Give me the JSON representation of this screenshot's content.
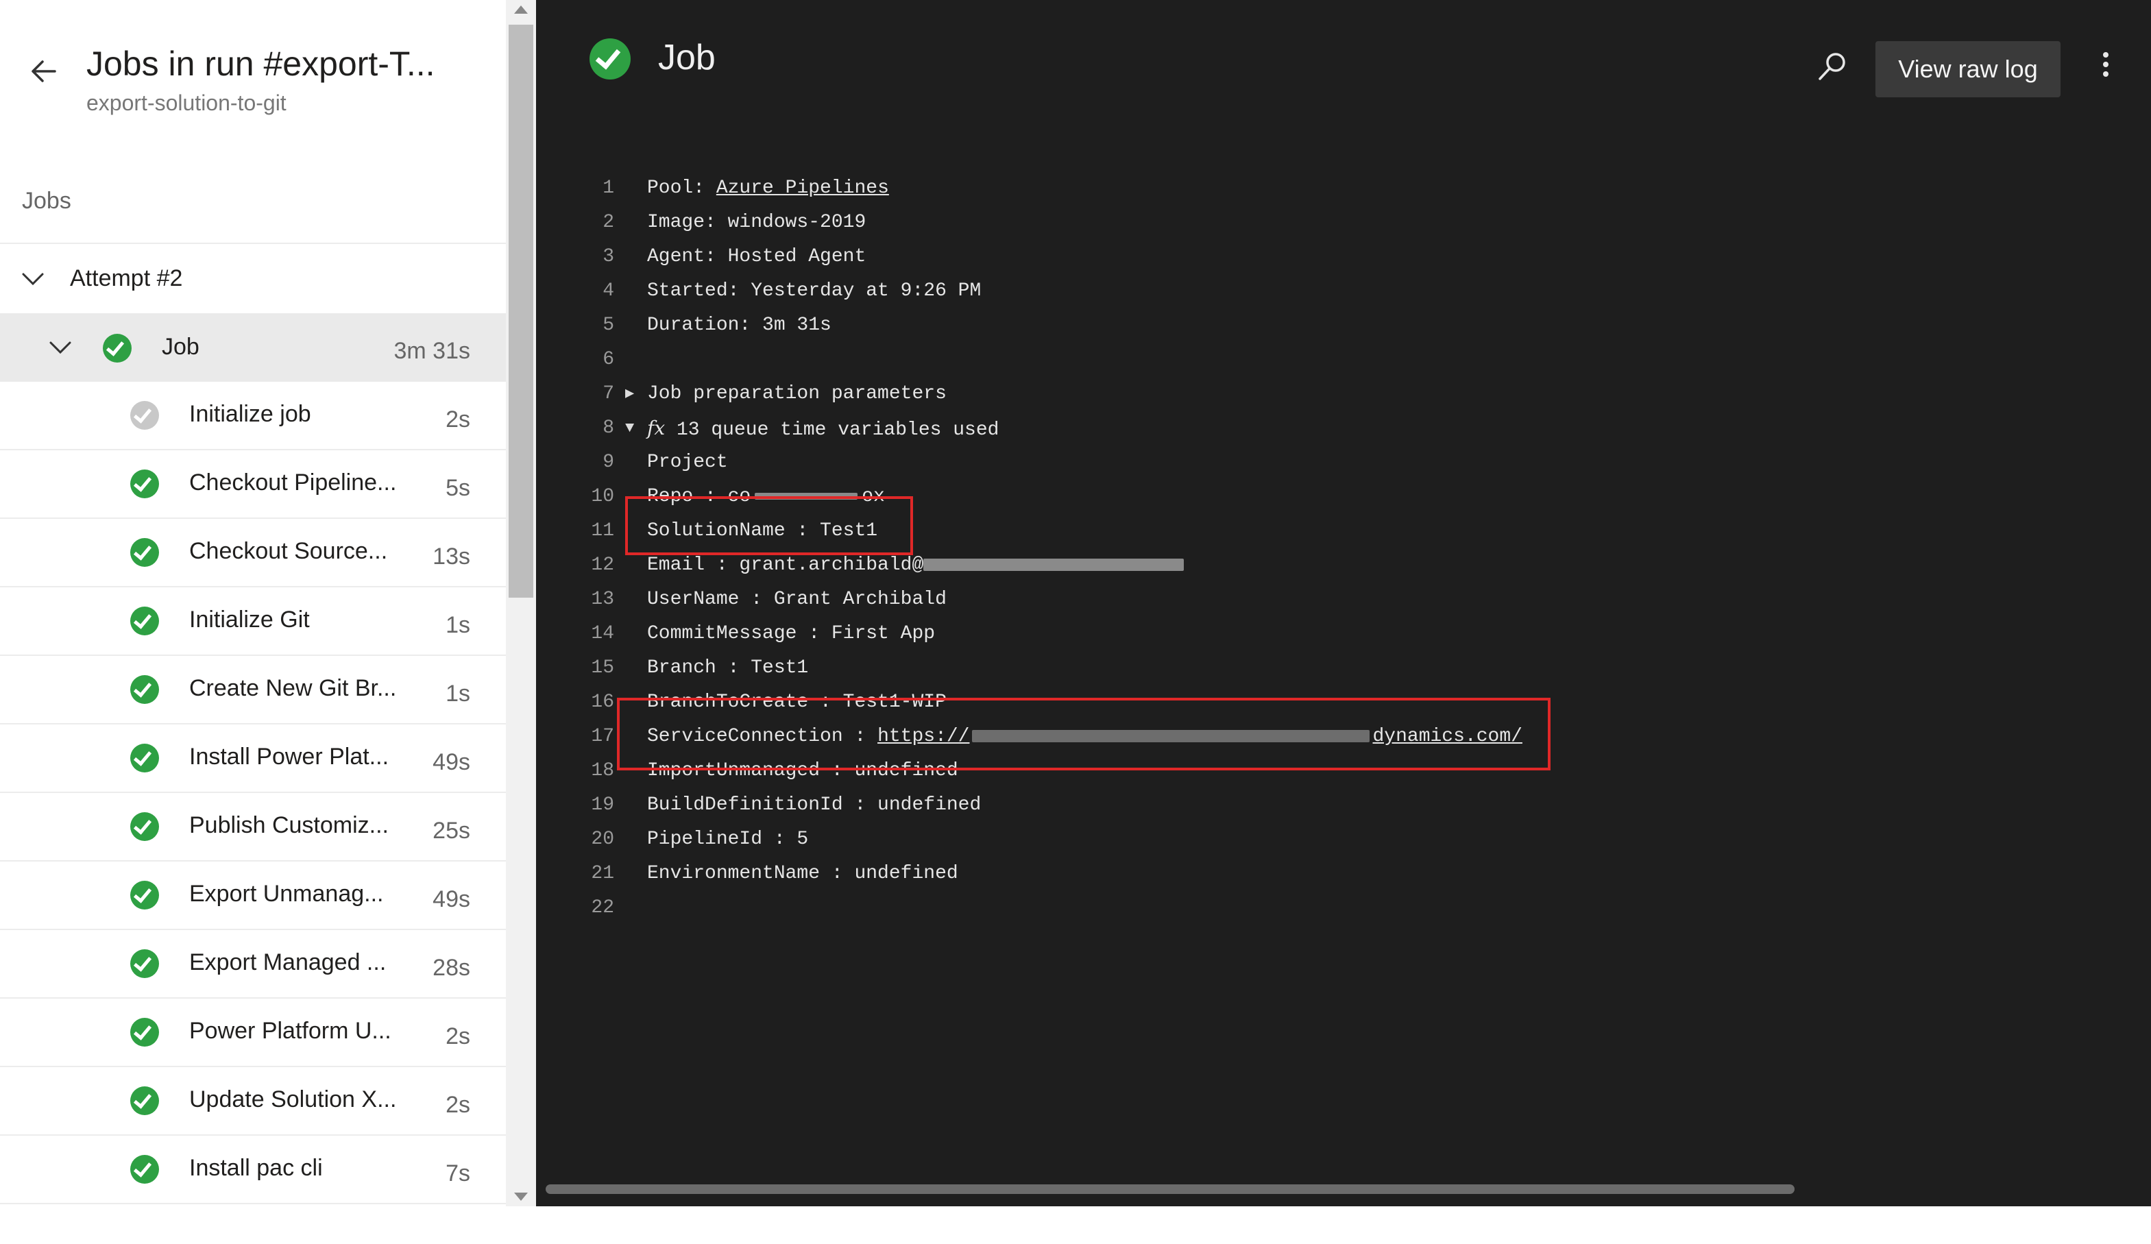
{
  "header": {
    "run_title": "Jobs in run #export-T...",
    "run_subtitle": "export-solution-to-git"
  },
  "sidebar": {
    "section_label": "Jobs",
    "attempt_label": "Attempt #2",
    "job": {
      "label": "Job",
      "duration": "3m 31s",
      "status": "succeeded"
    },
    "steps": [
      {
        "label": "Initialize job",
        "duration": "2s",
        "status": "pending"
      },
      {
        "label": "Checkout Pipeline...",
        "duration": "5s",
        "status": "succeeded"
      },
      {
        "label": "Checkout Source...",
        "duration": "13s",
        "status": "succeeded"
      },
      {
        "label": "Initialize Git",
        "duration": "1s",
        "status": "succeeded"
      },
      {
        "label": "Create New Git Br...",
        "duration": "1s",
        "status": "succeeded"
      },
      {
        "label": "Install Power Plat...",
        "duration": "49s",
        "status": "succeeded"
      },
      {
        "label": "Publish Customiz...",
        "duration": "25s",
        "status": "succeeded"
      },
      {
        "label": "Export Unmanag...",
        "duration": "49s",
        "status": "succeeded"
      },
      {
        "label": "Export Managed ...",
        "duration": "28s",
        "status": "succeeded"
      },
      {
        "label": "Power Platform U...",
        "duration": "2s",
        "status": "succeeded"
      },
      {
        "label": "Update Solution X...",
        "duration": "2s",
        "status": "succeeded"
      },
      {
        "label": "Install pac cli",
        "duration": "7s",
        "status": "succeeded"
      }
    ]
  },
  "main": {
    "title": "Job",
    "view_raw_log_label": "View raw log",
    "log": {
      "l1_key": "Pool: ",
      "l1_link": "Azure Pipelines",
      "l2": "Image: windows-2019",
      "l3": "Agent: Hosted Agent",
      "l4": "Started: Yesterday at 9:26 PM",
      "l5": "Duration: 3m 31s",
      "l7": "Job preparation parameters",
      "l8_fx": "fx",
      "l8": " 13 queue time variables used",
      "l9": "Project",
      "l10": "Repo : co",
      "l10_tail": "ox",
      "l11": "SolutionName : Test1",
      "l12": "Email : grant.archibald@",
      "l13": "UserName : Grant Archibald",
      "l14": "CommitMessage : First App",
      "l15": "Branch : Test1",
      "l16": "BranchToCreate : Test1-WIP",
      "l17_key": "ServiceConnection : ",
      "l17_link_start": "https://",
      "l17_link_end": "dynamics.com/",
      "l18": "ImportUnmanaged : undefined",
      "l19": "BuildDefinitionId : undefined",
      "l20": "PipelineId : 5",
      "l21": "EnvironmentName : undefined"
    }
  },
  "colors": {
    "success": "#2ea043",
    "highlight": "#e02828",
    "log_background": "#1e1e1e"
  }
}
